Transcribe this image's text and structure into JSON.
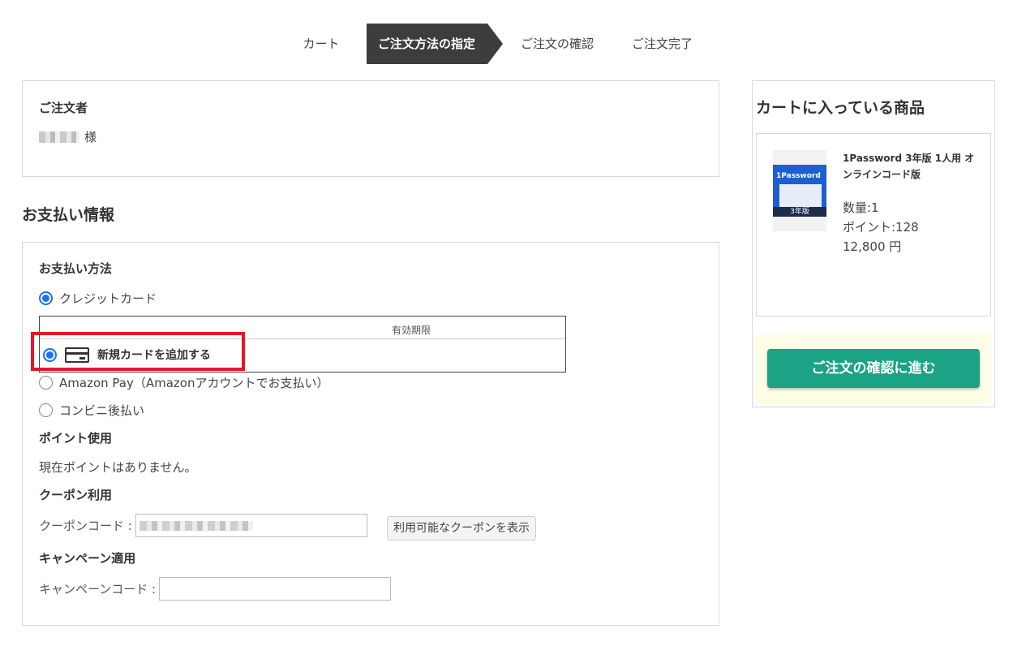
{
  "steps": [
    "カート",
    "ご注文方法の指定",
    "ご注文の確認",
    "ご注文完了"
  ],
  "orderer": {
    "label": "ご注文者",
    "name_suffix": "様"
  },
  "payment_section_title": "お支払い情報",
  "payment": {
    "method_label": "お支払い方法",
    "options": {
      "credit": "クレジットカード",
      "amazon": "Amazon Pay（Amazonアカウントでお支払い）",
      "konbini": "コンビニ後払い"
    },
    "card_table_header": "有効期限",
    "new_card_label": "新規カードを追加する"
  },
  "points": {
    "label": "ポイント使用",
    "message": "現在ポイントはありません。"
  },
  "coupon": {
    "label": "クーポン利用",
    "field_label": "クーポンコード :",
    "show_button": "利用可能なクーポンを表示"
  },
  "campaign": {
    "label": "キャンペーン適用",
    "field_label": "キャンペーンコード :"
  },
  "cart": {
    "title": "カートに入っている商品",
    "item": {
      "thumb_brand": "1Password",
      "thumb_band": "3年版",
      "name": "1Password 3年版 1人用 オンラインコード版",
      "quantity": "数量:1",
      "points": "ポイント:128",
      "price": "12,800 円"
    },
    "cta": "ご注文の確認に進む"
  }
}
